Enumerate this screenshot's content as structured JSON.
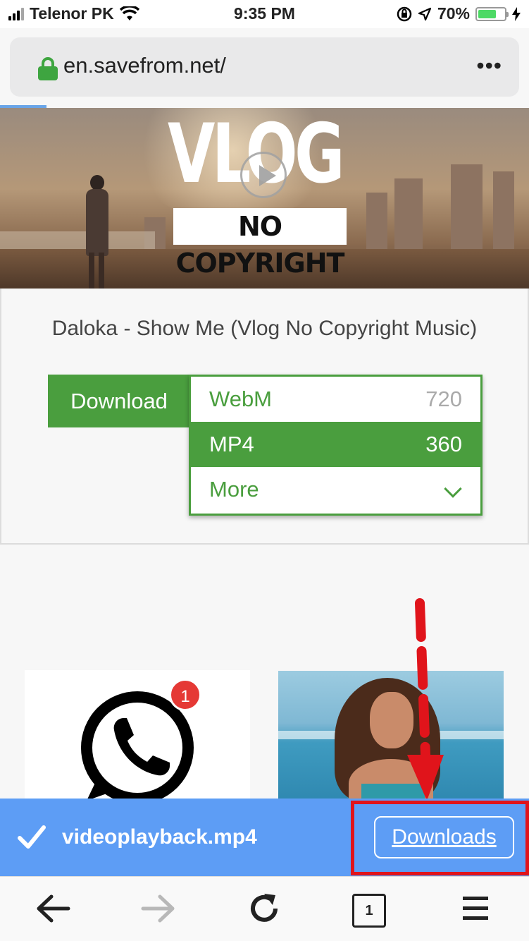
{
  "status_bar": {
    "carrier": "Telenor PK",
    "time": "9:35 PM",
    "battery": "70%",
    "battery_level": 0.7
  },
  "url_bar": {
    "url": "en.savefrom.net/"
  },
  "video": {
    "thumb_title": "VLOG",
    "thumb_subtitle": "NO COPYRIGHT",
    "title": "Daloka - Show Me (Vlog No Copyright Music)"
  },
  "download": {
    "button_label": "Download",
    "options": [
      {
        "format": "WebM",
        "quality": "720"
      },
      {
        "format": "MP4",
        "quality": "360"
      },
      {
        "format": "More",
        "quality": ""
      }
    ]
  },
  "ads": {
    "whatsapp_badge": "1"
  },
  "download_bar": {
    "filename": "videoplayback.mp4",
    "button_label": "Downloads"
  },
  "toolbar": {
    "tab_count": "1"
  },
  "colors": {
    "accent_green": "#4a9e3e",
    "download_bar_blue": "#5d9df5",
    "highlight_red": "#e0141b"
  }
}
